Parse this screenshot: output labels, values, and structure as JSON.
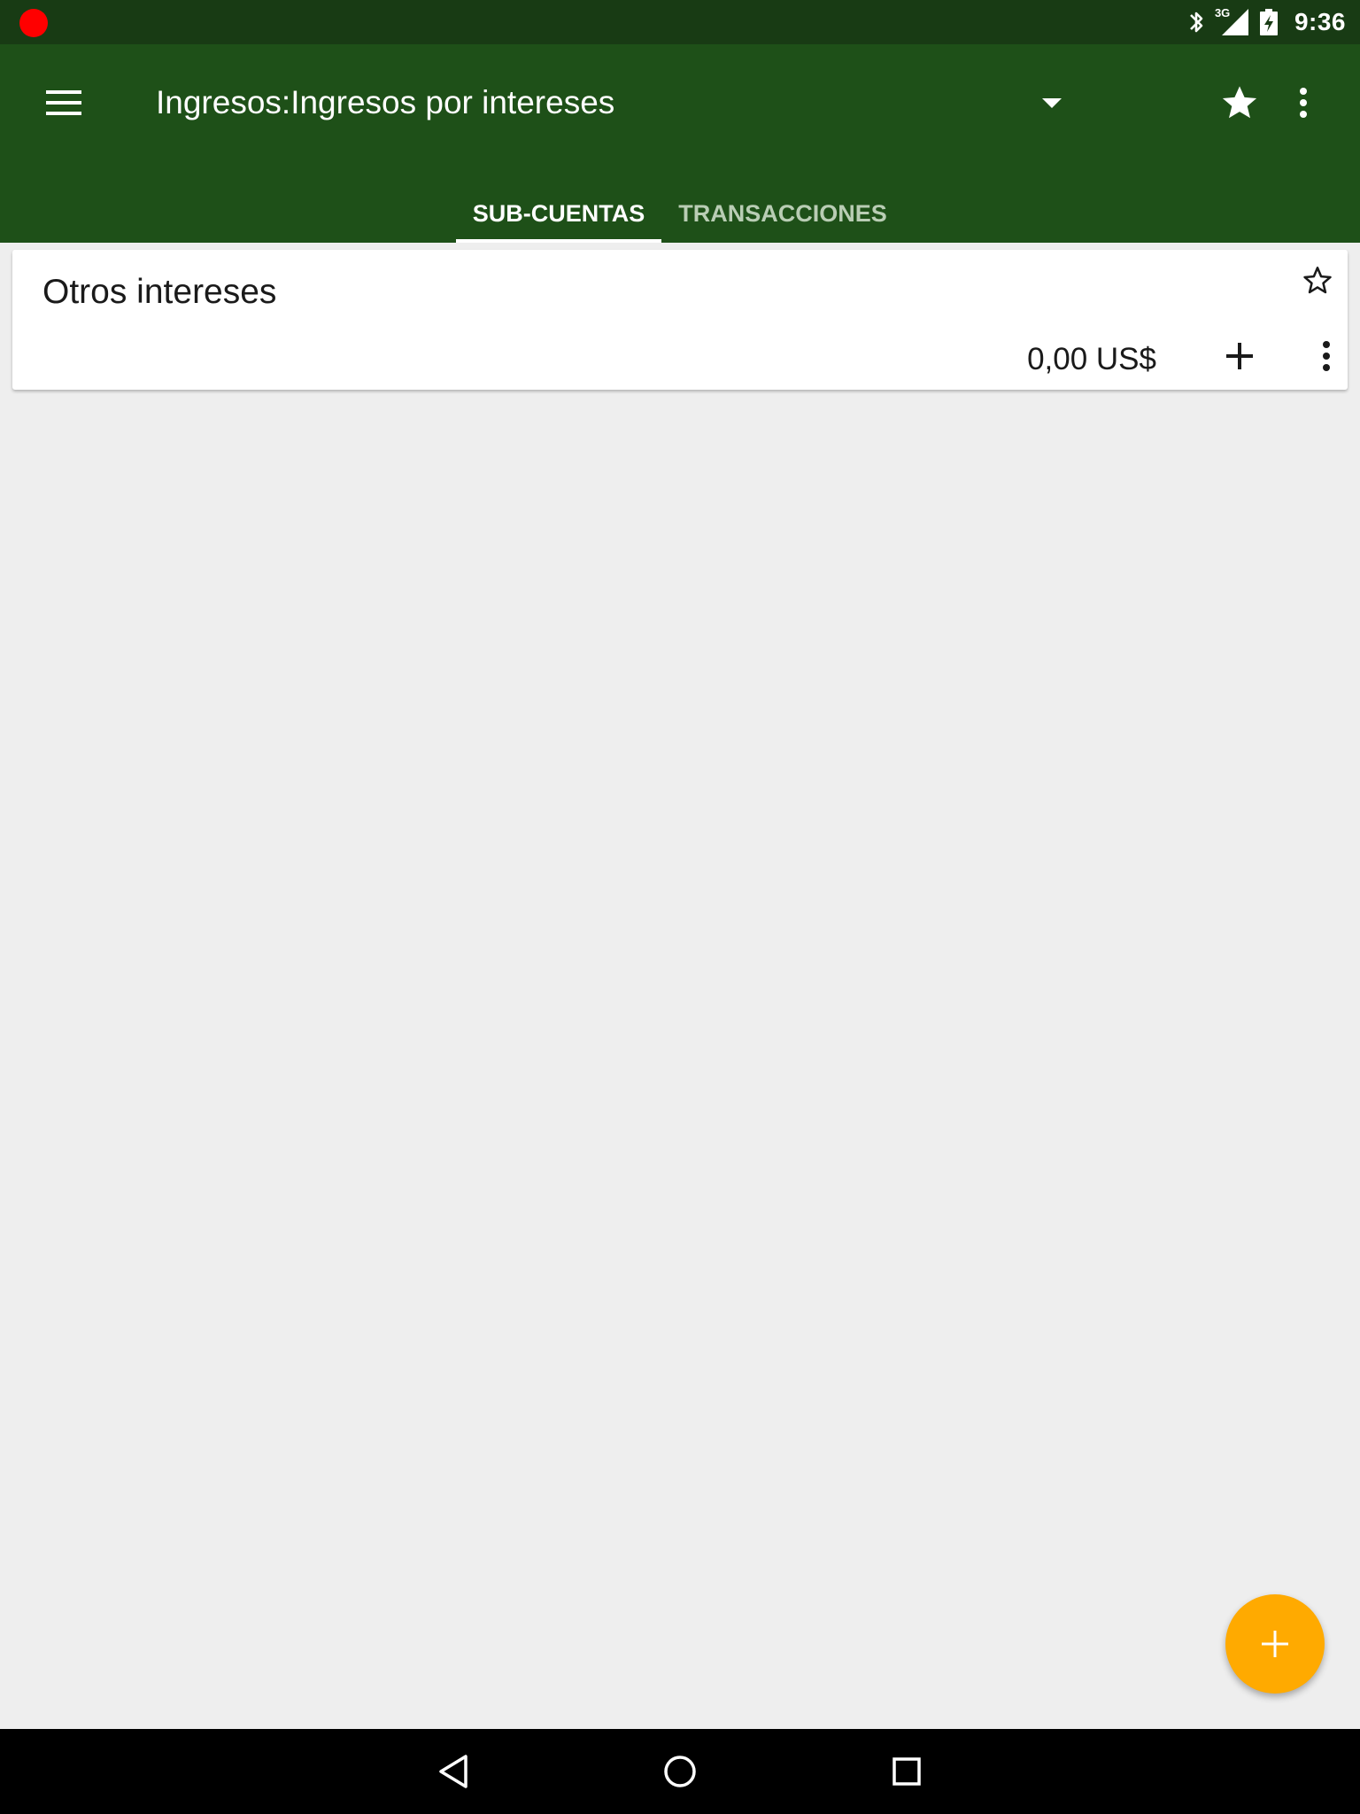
{
  "status_bar": {
    "time": "9:36",
    "network_label": "3G",
    "icons": [
      "recording-dot-icon",
      "bluetooth-icon",
      "cell-signal-icon",
      "battery-charging-icon"
    ]
  },
  "app_bar": {
    "title": "Ingresos:Ingresos por intereses",
    "icons": [
      "menu-icon",
      "dropdown-arrow-icon",
      "star-filled-icon",
      "more-vertical-icon"
    ],
    "tabs": [
      {
        "label": "SUB-CUENTAS",
        "selected": true
      },
      {
        "label": "TRANSACCIONES",
        "selected": false
      }
    ]
  },
  "accounts": [
    {
      "name": "Otros intereses",
      "balance": "0,00 US$",
      "favorite": false
    }
  ],
  "fab": {
    "icon": "plus-icon"
  },
  "nav_bar": {
    "icons": [
      "back-icon",
      "home-icon",
      "recents-icon"
    ]
  },
  "colors": {
    "status_bar": "#183b14",
    "app_bar": "#1e5018",
    "background": "#eeeeee",
    "fab": "#ffaa00",
    "tab_inactive": "#b9cdb4"
  }
}
